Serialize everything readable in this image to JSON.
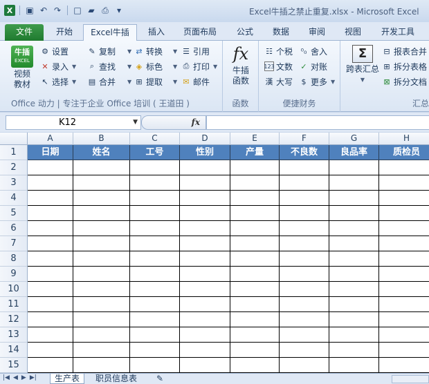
{
  "window": {
    "title": "Excel牛插之禁止重复.xlsx - Microsoft Excel"
  },
  "qat": {
    "icons": [
      "excel-logo-icon",
      "save-icon",
      "undo-icon",
      "redo-icon",
      "new-icon",
      "open-icon",
      "print-preview-icon",
      "customize-icon"
    ]
  },
  "tabs": [
    "文件",
    "开始",
    "Excel牛插",
    "插入",
    "页面布局",
    "公式",
    "数据",
    "审阅",
    "视图",
    "开发工具"
  ],
  "ribbon": {
    "logo_text": "牛插",
    "logo_sub": "EXCEL",
    "video_label": "视频\n教材",
    "col1": [
      "设置",
      "录入",
      "选择"
    ],
    "col2": [
      "复制",
      "查找",
      "合并"
    ],
    "col3": [
      "转换",
      "标色",
      "提取"
    ],
    "col4": [
      "引用",
      "打印",
      "邮件"
    ],
    "group1_label": "Office 动力 | 专注于企业 Office 培训 ( 王道田 )",
    "fx_label": "牛插\n函数",
    "fx_group_label": "函数",
    "fin_col1": [
      "个税",
      "文数",
      "大写"
    ],
    "fin_col2": [
      "舍入",
      "对账",
      "更多"
    ],
    "fin_group_label": "便捷财务",
    "sum_big_label": "跨表汇总",
    "sum_col": [
      "报表合并",
      "拆分表格",
      "拆分文档"
    ],
    "sum_group_label": "汇总"
  },
  "formula_bar": {
    "name_box": "K12",
    "fx": "fx",
    "formula": ""
  },
  "sheet": {
    "columns": [
      "A",
      "B",
      "C",
      "D",
      "E",
      "F",
      "G",
      "H"
    ],
    "headers": [
      "日期",
      "姓名",
      "工号",
      "性别",
      "产量",
      "不良数",
      "良品率",
      "质检员"
    ],
    "rows": [
      "1",
      "2",
      "3",
      "4",
      "5",
      "6",
      "7",
      "8",
      "9",
      "10",
      "11",
      "12",
      "13",
      "14",
      "15"
    ]
  },
  "sheet_tabs": [
    "生产表",
    "职员信息表"
  ],
  "colors": {
    "header_fill": "#4f81bd",
    "file_tab": "#2a8a38"
  }
}
